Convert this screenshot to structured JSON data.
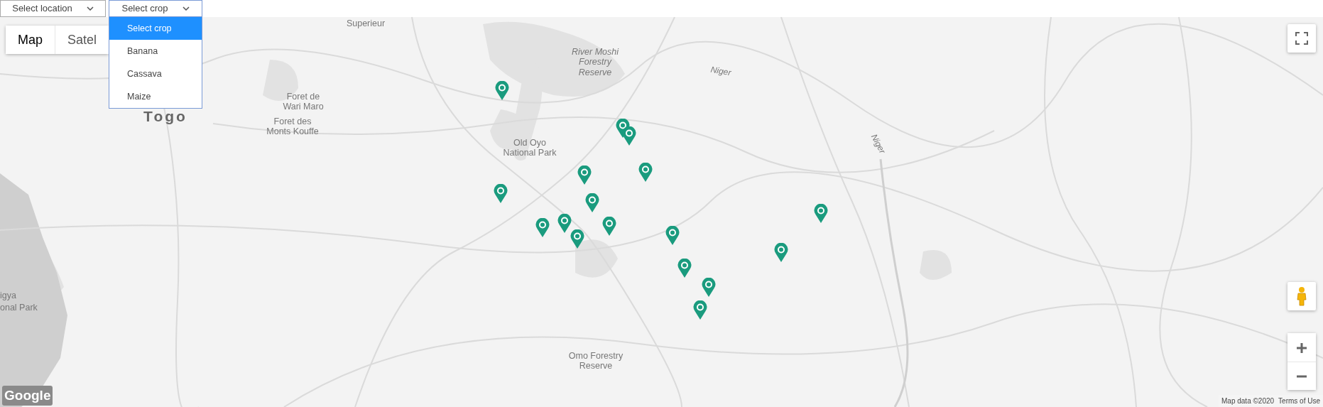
{
  "location_select": {
    "value": "Select location"
  },
  "crop_select": {
    "value": "Select crop",
    "expanded": true,
    "options": [
      {
        "label": "Select crop",
        "selected": true
      },
      {
        "label": "Banana",
        "selected": false
      },
      {
        "label": "Cassava",
        "selected": false
      },
      {
        "label": "Maize",
        "selected": false
      }
    ]
  },
  "map": {
    "type_control": [
      {
        "label": "Map",
        "selected": true
      },
      {
        "label": "Satel",
        "selected": false
      }
    ],
    "labels": [
      {
        "text": "Superieur",
        "kind": "place"
      },
      {
        "text": "Foret de\nWari Maro",
        "kind": "place"
      },
      {
        "text": "Foret des\nMonts Kouffe",
        "kind": "place"
      },
      {
        "text": "Togo",
        "kind": "country"
      },
      {
        "text": "River Moshi\nForestry\nReserve",
        "kind": "reserve"
      },
      {
        "text": "Niger",
        "kind": "river"
      },
      {
        "text": "Niger",
        "kind": "river"
      },
      {
        "text": "Old Oyo\nNational Park",
        "kind": "place"
      },
      {
        "text": "Omo Forestry\nReserve",
        "kind": "place"
      },
      {
        "text": "igya",
        "kind": "place"
      },
      {
        "text": "onal Park",
        "kind": "place"
      }
    ],
    "logo": "Google",
    "attribution": "Map data ©2020",
    "terms_link": "Terms of Use"
  }
}
